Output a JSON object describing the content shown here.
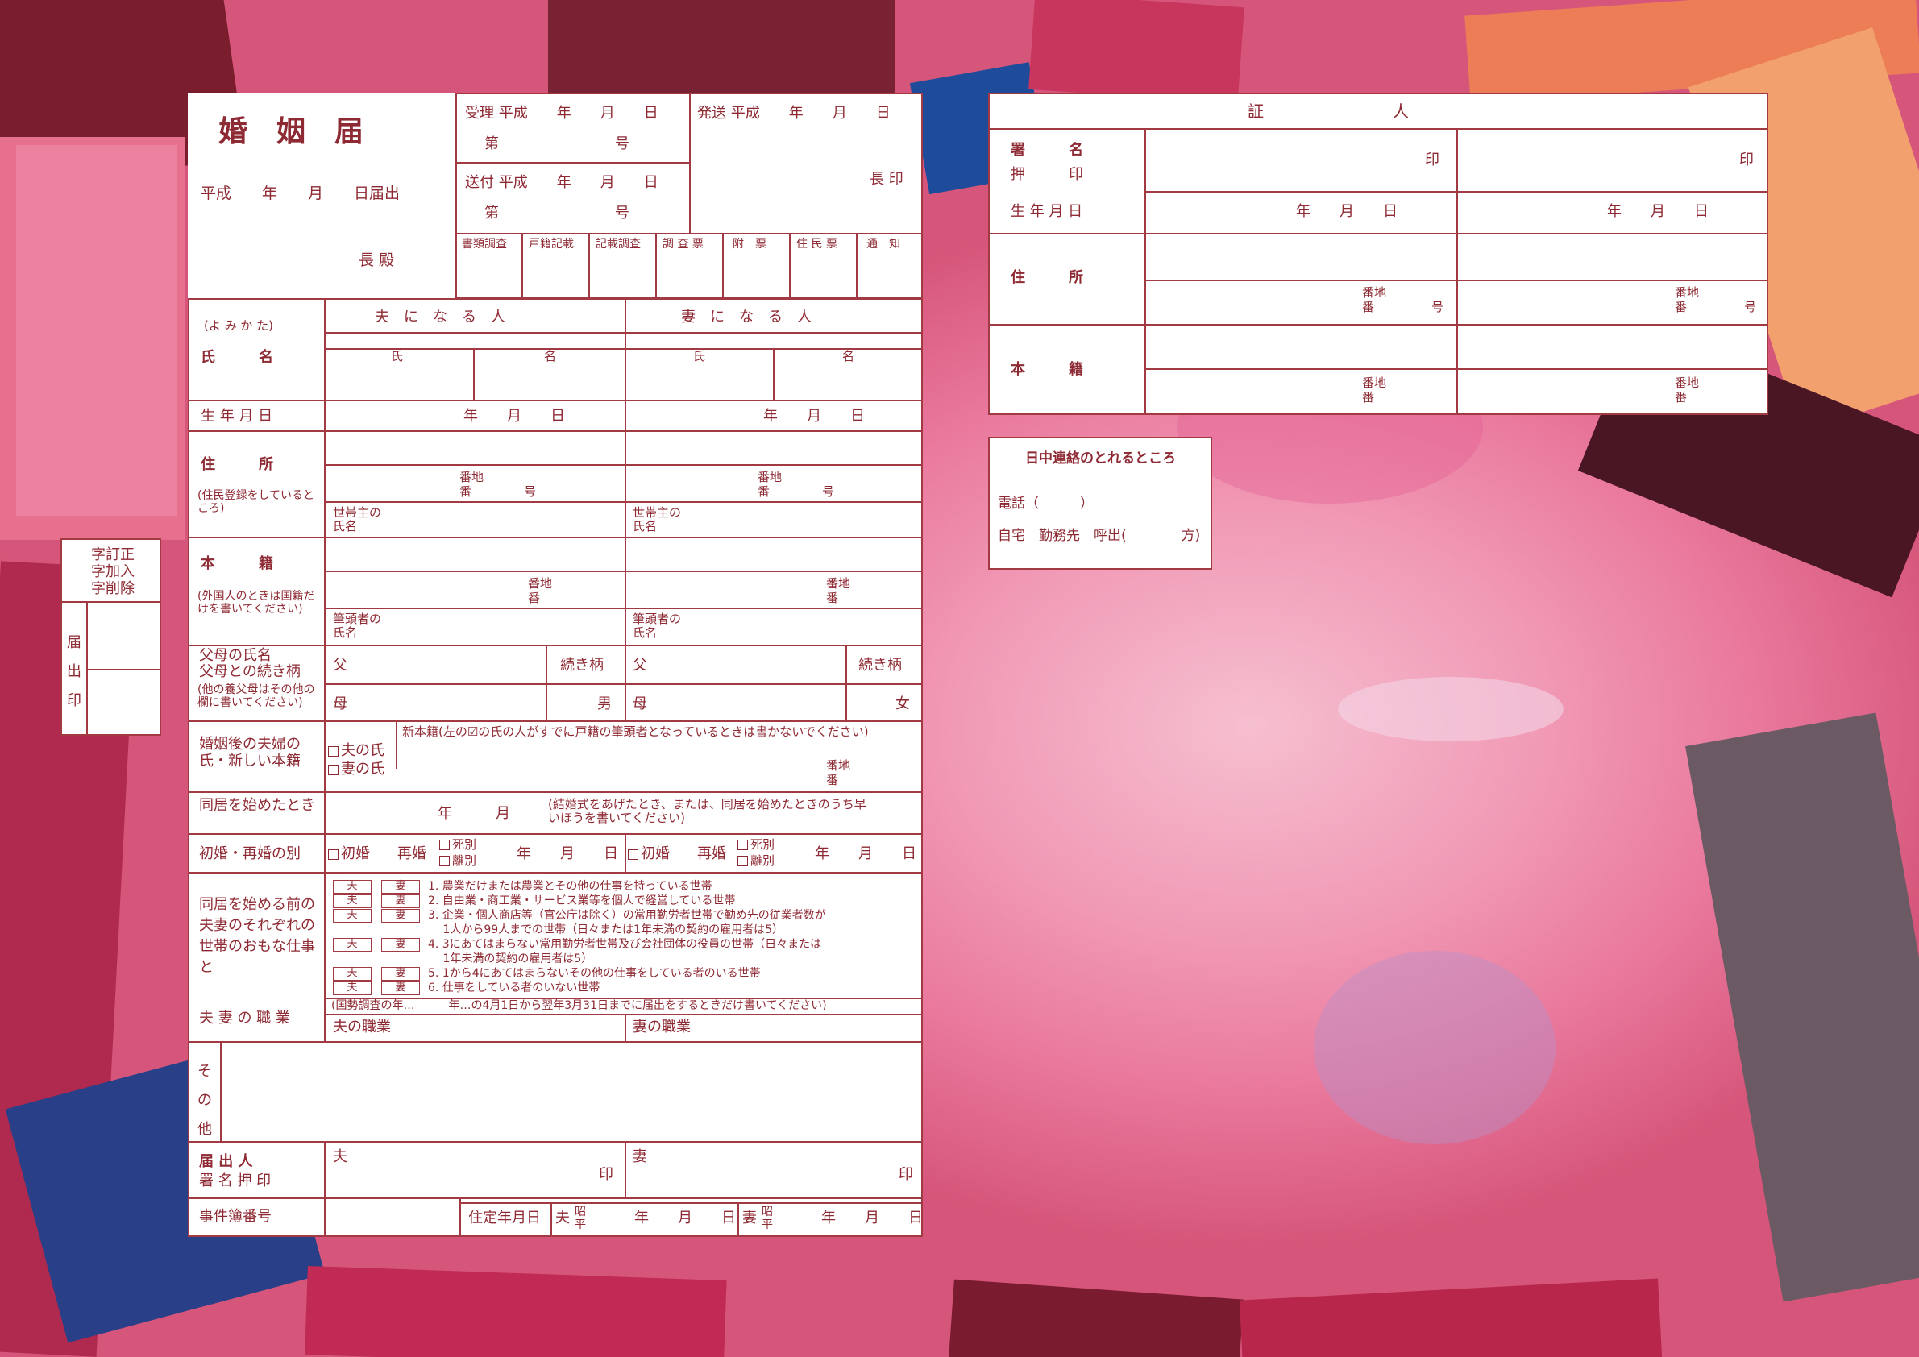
{
  "main": {
    "title": "婚　姻　届",
    "date_line": "平成　　年　　月　　日届出",
    "recipient": "長 殿"
  },
  "office": {
    "received": "受理 平成　　年　　月　　日",
    "received_no": "第　　　　　　　　号",
    "sent_date": "発送 平成　　年　　月　　日",
    "forwarded": "送付 平成　　年　　月　　日",
    "forwarded_no": "第　　　　　　　　号",
    "head_seal": "長 印",
    "checks": [
      "書類調査",
      "戸籍記載",
      "記載調査",
      "調 査 票",
      "附　票",
      "住 民 票",
      "通　知"
    ]
  },
  "table": {
    "yomikata": "(よ み か た)",
    "husband_header": "夫　に　な　る　人",
    "wife_header": "妻　に　な　る　人",
    "name_label": "氏　　　名",
    "surname": "氏",
    "given": "名",
    "birth_label": "生 年 月 日",
    "date_ymd": "年　　月　　日",
    "address_label": "住　　　所",
    "address_note": "(住民登録をしているところ)",
    "banchi": "番地",
    "ban": "番",
    "gou": "号",
    "head_of_household": "世帯主の氏名",
    "honseki_label": "本　　　籍",
    "honseki_note": "(外国人のときは国籍だけを書いてください)",
    "register_head": "筆頭者の氏名",
    "parents_label1": "父母の氏名",
    "parents_label2": "父母との続き柄",
    "parents_note": "(他の養父母はその他の欄に書いてください)",
    "father": "父",
    "mother": "母",
    "relation": "続き柄",
    "son": "男",
    "daughter": "女",
    "surname_after_label": "婚姻後の夫婦の氏・新しい本籍",
    "husband_surname": "夫の氏",
    "wife_surname": "妻の氏",
    "new_honseki": "新本籍(左の☑の氏の人がすでに戸籍の筆頭者となっているときは書かないでください)",
    "cohabit_label": "同居を始めたとき",
    "cohabit_ym": "年　　　月",
    "cohabit_note": "(結婚式をあげたとき、または、同居を始めたときのうち早いほうを書いてください)",
    "marriage_label": "初婚・再婚の別",
    "first": "初婚",
    "remarriage": "再婚",
    "death": "死別",
    "divorce": "離別",
    "work_label": "同居を始める前の夫妻のそれぞれの世帯のおもな仕事と",
    "occupations_label": "夫 妻 の 職 業",
    "husband_box": "夫",
    "wife_box": "妻",
    "work_items": [
      "1. 農業だけまたは農業とその他の仕事を持っている世帯",
      "2. 自由業・商工業・サービス業等を個人で経営している世帯",
      "3. 企業・個人商店等（官公庁は除く）の常用勤労者世帯で勤め先の従業者数が",
      "　 1人から99人までの世帯（日々または1年未満の契約の雇用者は5）",
      "4. 3にあてはまらない常用勤労者世帯及び会社団体の役員の世帯（日々または",
      "　 1年未満の契約の雇用者は5）",
      "5. 1から4にあてはまらないその他の仕事をしている者のいる世帯",
      "6. 仕事をしている者のいない世帯"
    ],
    "census_note": "(国勢調査の年…　　　年…の4月1日から翌年3月31日までに届出をするときだけ書いてください)",
    "husband_job": "夫の職業",
    "wife_job": "妻の職業",
    "other_label": "その他",
    "signer_label1": "届 出 人",
    "signer_label2": "署 名 押 印",
    "husband": "夫",
    "wife": "妻",
    "seal": "印",
    "case_no": "事件簿番号",
    "residence_date": "住定年月日",
    "showa_heisei": "昭平"
  },
  "correction": {
    "title": "字訂正\n字加入\n字削除",
    "seal_label": "届出印"
  },
  "witness": {
    "header": "証　　　　　　　　人",
    "sign_label": "署　　　名",
    "press_label": "押　　　印",
    "seal": "印",
    "birth_label": "生 年 月 日",
    "date_ymd": "年　　月　　日",
    "address_label": "住　　　所",
    "banchi": "番地",
    "ban": "番",
    "gou": "号",
    "honseki_label": "本　　　籍"
  },
  "contact": {
    "title": "日中連絡のとれるところ",
    "phone": "電話（　　　）",
    "where": "自宅　勤務先　呼出(　　　　方)"
  },
  "colors": {
    "line": "#a23a44",
    "text": "#8e2a33",
    "background": "#f19ab6"
  }
}
